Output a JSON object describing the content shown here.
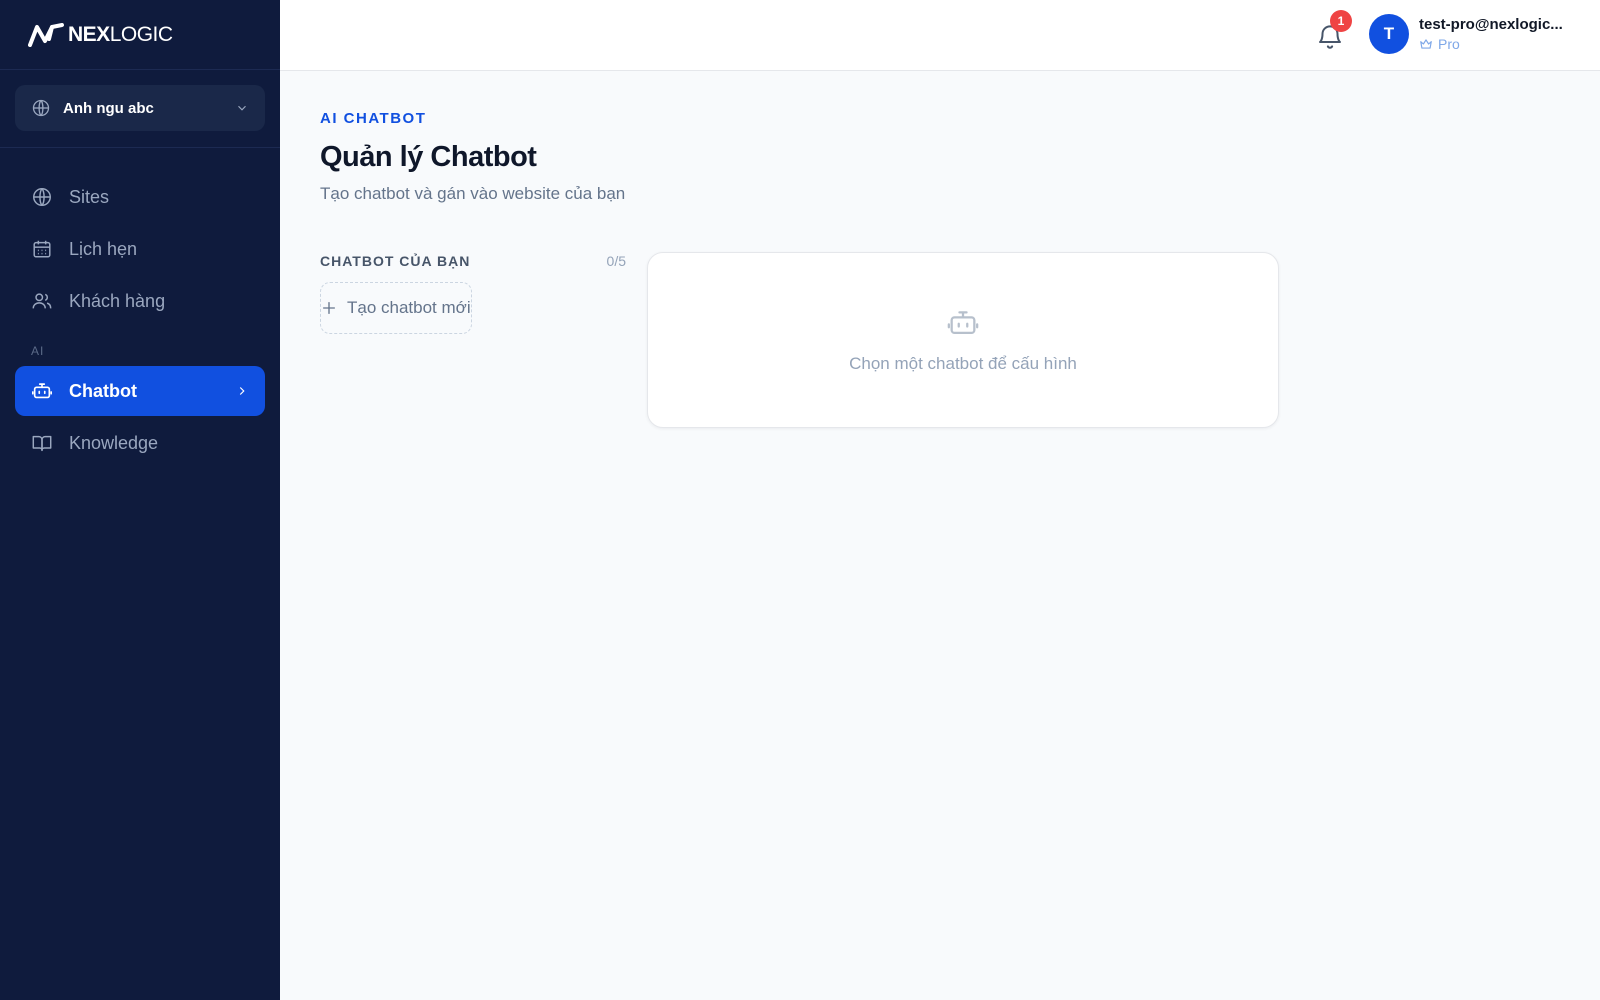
{
  "brand": {
    "name_bold": "NEX",
    "name_light": "LOGIC"
  },
  "site_selector": {
    "selected": "Anh ngu abc"
  },
  "sidebar": {
    "items": [
      {
        "label": "Sites",
        "icon": "globe-icon"
      },
      {
        "label": "Lịch hẹn",
        "icon": "calendar-icon"
      },
      {
        "label": "Khách hàng",
        "icon": "users-icon"
      }
    ],
    "section_ai": "AI",
    "ai_items": [
      {
        "label": "Chatbot",
        "icon": "bot-icon",
        "active": true
      },
      {
        "label": "Knowledge",
        "icon": "book-icon"
      }
    ]
  },
  "topbar": {
    "notification_count": "1",
    "user": {
      "avatar_letter": "T",
      "email": "test-pro@nexlogic...",
      "plan": "Pro"
    }
  },
  "main": {
    "eyebrow": "AI CHATBOT",
    "title": "Quản lý Chatbot",
    "subtitle": "Tạo chatbot và gán vào website của bạn",
    "list": {
      "title": "CHATBOT CỦA BẠN",
      "count": "0/5",
      "new_button": "Tạo chatbot mới"
    },
    "detail": {
      "empty_text": "Chọn một chatbot để cấu hình"
    }
  },
  "colors": {
    "sidebar_bg": "#0f1b3d",
    "accent": "#1150e0",
    "badge": "#ef4444",
    "page_bg": "#f8fafc"
  }
}
